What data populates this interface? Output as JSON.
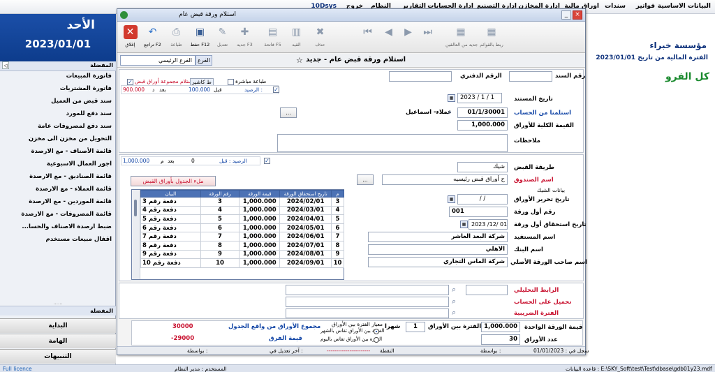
{
  "menubar": {
    "items": [
      "البيانات الاساسية",
      "فواتير",
      "سندات",
      "اوراق مالية",
      "ادارة المخازن",
      "ادارة التصنيع",
      "ادارة الحسابات",
      "التقارير",
      "النظام",
      "خروج",
      "10Dsys"
    ]
  },
  "sidebar": {
    "day": "الأحد",
    "date": "2023/01/01",
    "fav_header": "المفضلة",
    "fav_toggle": "◁",
    "items": [
      "فاتورة المبيعات",
      "فاتورة المشتريات",
      "سند قبض من العميل",
      "سند دفع للمورد",
      "سند دفع لمصروفات عامة",
      "التحويل من مخزن الى مخزن",
      "قائمة الأصناف - مع الارصدة",
      "اجور العمال الاسبوعية",
      "قائمة الصناديق - مع الارصدة",
      "قائمة العملاء - مع الارصدة",
      "قائمة الموردين - مع الارصدة",
      "قائمة المصروفات - مع الارصدة",
      "ضبط ارصدة الاصناف والحسا...",
      "اقفال مبيعات مستخدم"
    ],
    "dots": "......",
    "bottom_header": "المفضلة",
    "bottom_buttons": [
      "البداية",
      "الهامة",
      "التنبيهات"
    ]
  },
  "background": {
    "company": "مؤسسة خبراء",
    "fiscal": "الفترة المالية من تاريخ 2023/01/01",
    "green": "كل الفرو"
  },
  "dialog": {
    "title": "استلام ورقة قبض عام",
    "win_min": "_",
    "win_close": "×",
    "toolbar": [
      {
        "label": "إغلاق",
        "icon": "close-icon",
        "glyph": "✕"
      },
      {
        "label": "تراجع F2",
        "icon": "undo-icon",
        "glyph": "↶"
      },
      {
        "label": "طباعة",
        "icon": "print-icon",
        "glyph": "⎙"
      },
      {
        "label": "حفظ F12",
        "icon": "save-icon",
        "glyph": "▣"
      },
      {
        "label": "تعديل",
        "icon": "edit-icon",
        "glyph": "✎"
      },
      {
        "label": "جديد F3",
        "icon": "new-icon",
        "glyph": "✚"
      },
      {
        "label": "فاتحة F5",
        "icon": "folder-icon",
        "glyph": "▤"
      },
      {
        "label": "القيد",
        "icon": "entry-icon",
        "glyph": "▥"
      },
      {
        "label": "حذف",
        "icon": "delete-icon",
        "glyph": "✖"
      },
      {
        "label": "",
        "icon": "first-icon",
        "glyph": "⏮"
      },
      {
        "label": "",
        "icon": "prev-icon",
        "glyph": "◀"
      },
      {
        "label": "",
        "icon": "next-icon",
        "glyph": "▶"
      },
      {
        "label": "",
        "icon": "last-icon",
        "glyph": "⏭"
      },
      {
        "label": "جديد من العالقين",
        "icon": "clipboard-icon",
        "glyph": "▦"
      },
      {
        "label": "ربط بالقوائم",
        "icon": "clipboard-link-icon",
        "glyph": "▦"
      }
    ],
    "branch_label": "الفرع",
    "branch_value": "الفرع الرئيسي",
    "doc_title": "استلام ورقة قبض عام  - جديد",
    "star": "☆"
  },
  "form": {
    "doc_no_label": "رقم السند",
    "office_no_label": "الرقم الدفتري",
    "direct_print": "طباعة مباشرة",
    "cashier": "ط كاشير",
    "receive_group": "استلام مجموعة أوراق قبض",
    "balance1": {
      "label": "الرصيد :",
      "before_lbl": "قبل",
      "before": "100.000",
      "after_lbl": "بعد",
      "after": "900.000",
      "after_suffix": "د"
    },
    "date_label": "تاريخ المستند",
    "date_value": "2023 / 1 / 1",
    "account_label": "استلمنا من الحساب",
    "account_code": "01/1/30001",
    "account_name": "عملاء- اسماعيل",
    "dots_btn": "...",
    "total_label": "القيمة الكلية للأوراق",
    "total_value": "1,000.000",
    "notes_label": "ملاحظات",
    "balance2": {
      "label": "الرصيد : قبل",
      "before": "0",
      "after_lbl": "بعد",
      "after": "1,000.000",
      "after_suffix": "م"
    },
    "method_label": "طريقة القبض",
    "method_value": "شيك",
    "box_label": "اسم الصندوق",
    "box_value": "ح أوراق قبض رئيسيه",
    "fill_button": "ملء الجدول بأوراق القبض",
    "check_section": "بيانات الشيك",
    "issue_date_label": "تاريخ تحرير الأوراق",
    "issue_date_value": "/ /",
    "first_no_label": "رقم أول ورقة",
    "first_no_value": "001",
    "due_label": "تاريخ استحقاق أول ورقة",
    "due_value": "2023 /12/ 01",
    "beneficiary_label": "اسم المستفيد",
    "beneficiary_value": "شركة البعد العاشر",
    "bank_label": "اسم البنك",
    "bank_value": "الاهلي",
    "owner_label": "اسم صاحب الورقة الأصلي",
    "owner_value": "شركة الماس التجاري",
    "analytic_label": "الرابط التحليلي",
    "load_label": "تحميل على الحساب",
    "tax_label": "الفترة الضريبية"
  },
  "grid": {
    "headers": [
      "م",
      "تاريخ استحقاق الورقة",
      "قيمة الورقة",
      "رقم الورقة",
      "البيان"
    ],
    "rows": [
      [
        "3",
        "2024/02/01",
        "1,000.000",
        "3",
        "دفعة رقم 3"
      ],
      [
        "4",
        "2024/03/01",
        "1,000.000",
        "4",
        "دفعة رقم 4"
      ],
      [
        "5",
        "2024/04/01",
        "1,000.000",
        "5",
        "دفعة رقم 5"
      ],
      [
        "6",
        "2024/05/01",
        "1,000.000",
        "6",
        "دفعة رقم 6"
      ],
      [
        "7",
        "2024/06/01",
        "1,000.000",
        "7",
        "دفعة رقم 7"
      ],
      [
        "8",
        "2024/07/01",
        "1,000.000",
        "8",
        "دفعة رقم 8"
      ],
      [
        "9",
        "2024/08/01",
        "1,000.000",
        "9",
        "دفعة رقم 9"
      ],
      [
        "10",
        "2024/09/01",
        "1,000.000",
        "10",
        "دفعة رقم 10"
      ]
    ]
  },
  "summary": {
    "unit_label": "قيمة الورقة الواحدة",
    "unit_value": "1,000.000",
    "count_label": "عدد الأوراق",
    "count_value": "30",
    "period_label": "الفترة بين الأوراق",
    "period_value": "1",
    "period_unit": "شهرا",
    "criteria_label": "معيار الفترة بين الأوراق",
    "opt1": "الفترة بين الأوراق تقاس بالشهر",
    "opt2": "الفترة بين الأوراق تقاس باليوم",
    "sum_label": "مجموع الأوراق من واقع الجدول",
    "sum_value": "30000",
    "diff_label": "قيمة الفرق",
    "diff_value": "29000-"
  },
  "dlg_status": {
    "recorded": "سجل في : 01/01/2023",
    "by1": "بواسطة :",
    "points": "النقطة",
    "dashes": "-----------------------",
    "last_edit": "آخر تعديل في :",
    "by2": "بواسطة :"
  },
  "status": {
    "licence": "Full licence",
    "user": "المستخدم : مدير النظام",
    "path": "قاعدة البيانات : E:\\SKY_Soft\\test\\Test\\dbase\\gdb01y23.mdf"
  },
  "colors": {
    "accent": "#0d3c8c",
    "red": "#c8102e",
    "blue": "#1346a6",
    "green": "#1a8a2e",
    "grid_header": "#4c72b5"
  }
}
